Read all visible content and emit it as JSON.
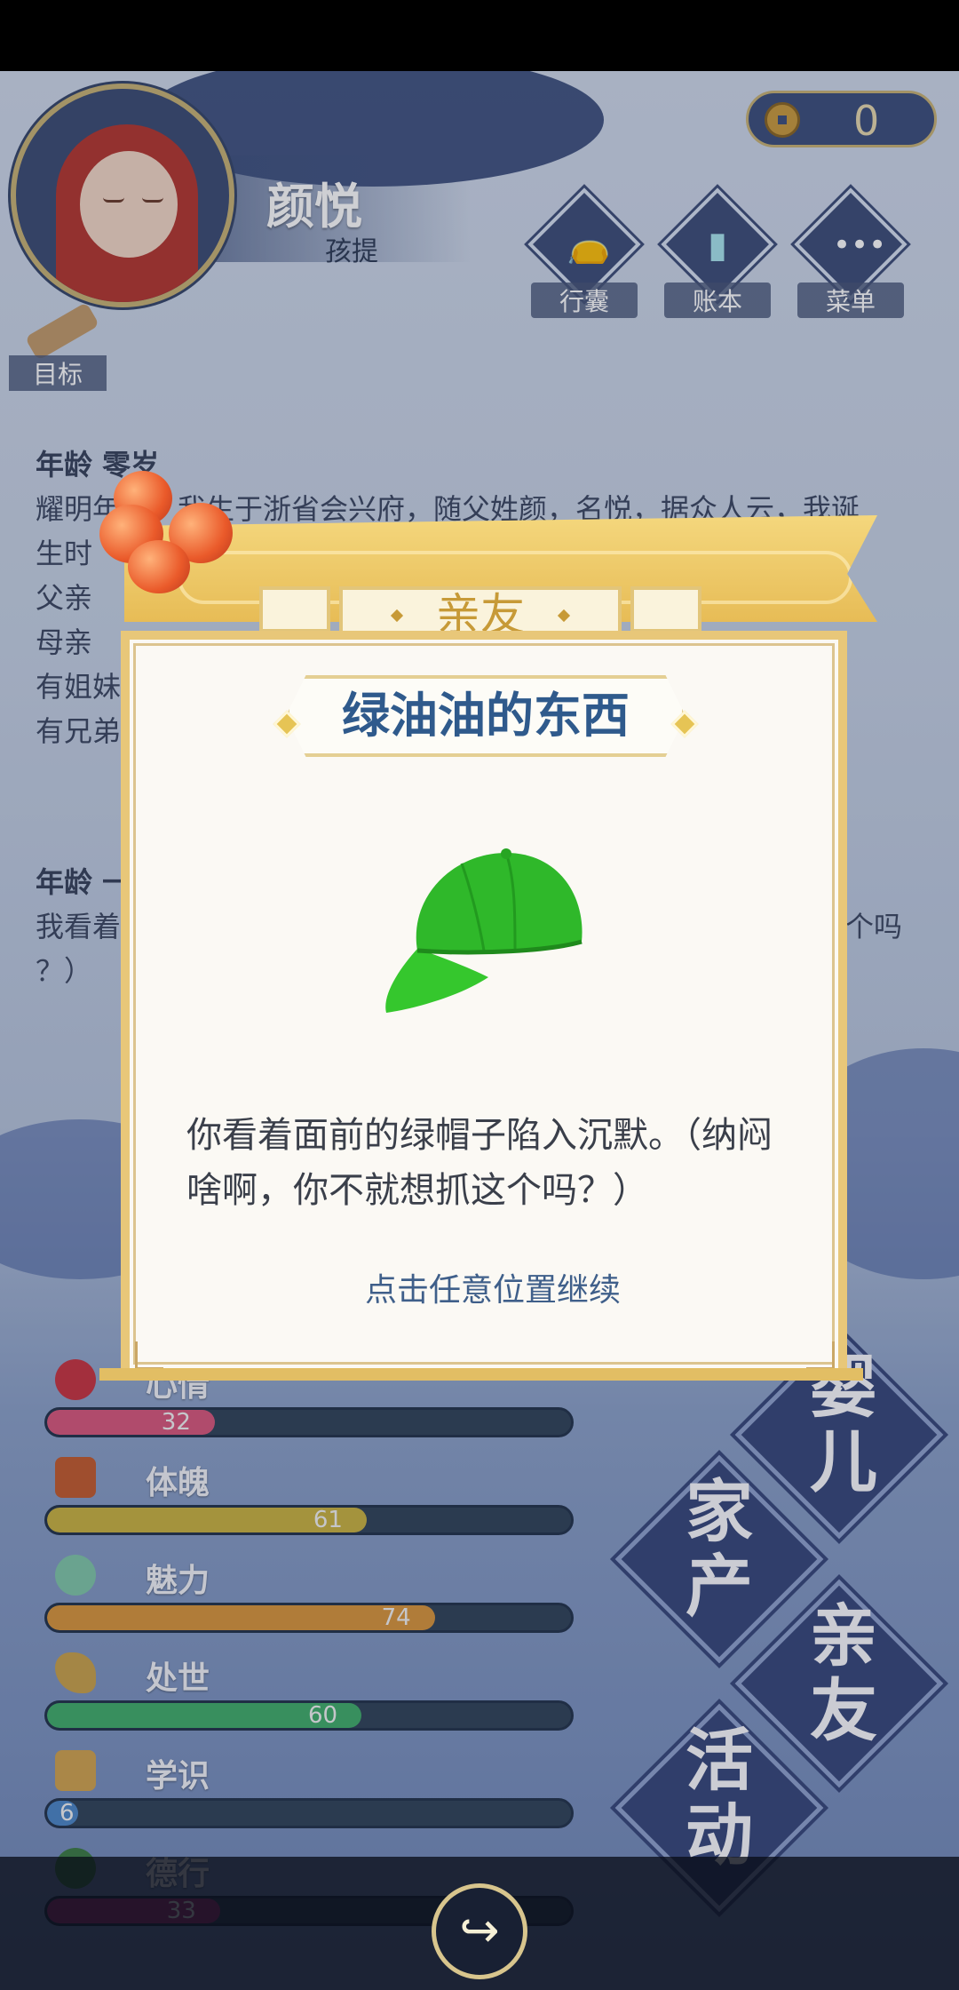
{
  "player": {
    "name": "颜悦",
    "stage": "孩提"
  },
  "currency": {
    "coin_icon": "copper-coin-icon",
    "count": "0"
  },
  "top_menu": [
    {
      "label": "行囊",
      "icon": "bag-icon"
    },
    {
      "label": "账本",
      "icon": "ledger-icon"
    },
    {
      "label": "菜单",
      "icon": "more-icon"
    }
  ],
  "goal": {
    "label": "目标"
  },
  "story": {
    "entry1": {
      "age": "年龄 零岁",
      "lines": [
        "耀明年间，我生于浙省会兴府，随父姓颜，名悦，据众人云，我诞",
        "生时",
        "父亲",
        "母亲",
        "有姐妹",
        "有兄弟"
      ]
    },
    "entry2": {
      "age": "年龄 一",
      "lines": [
        "我看着",
        "个吗",
        "？）"
      ]
    }
  },
  "stats": [
    {
      "label": "心情",
      "value": 32,
      "max": 100,
      "color": "#d9577b"
    },
    {
      "label": "体魄",
      "value": 61,
      "max": 100,
      "color": "#c9b23f"
    },
    {
      "label": "魅力",
      "value": 74,
      "max": 100,
      "color": "#d9953a"
    },
    {
      "label": "处世",
      "value": 60,
      "max": 100,
      "color": "#3fae6a"
    },
    {
      "label": "学识",
      "value": 6,
      "max": 100,
      "color": "#4b86c7"
    },
    {
      "label": "德行",
      "value": 33,
      "max": 100,
      "color": "#a4307a"
    }
  ],
  "tiles": [
    "婴儿",
    "家产",
    "亲友",
    "活动"
  ],
  "modal": {
    "tab_label": "亲友",
    "item_title": "绿油油的东西",
    "item_image": "green-cap",
    "item_color": "#2fb82a",
    "description": "你看着面前的绿帽子陷入沉默。（纳闷啥啊，你不就想抓这个吗？）",
    "continue_hint": "点击任意位置继续"
  },
  "bottom": {
    "share_icon": "share-icon"
  }
}
